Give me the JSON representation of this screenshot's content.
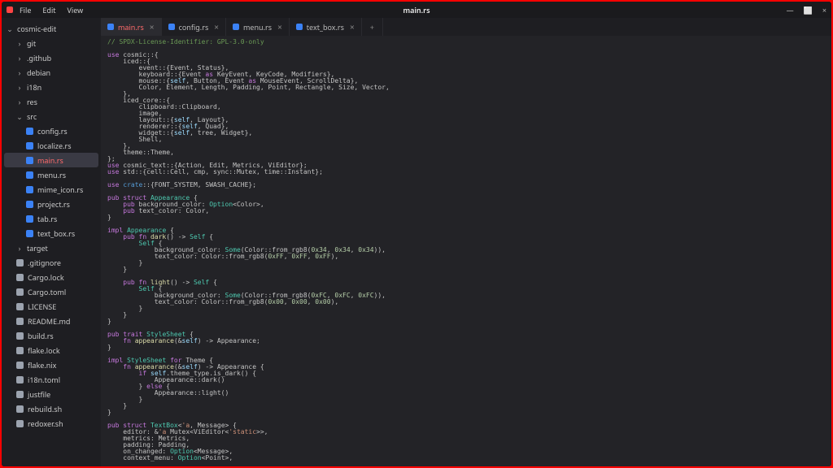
{
  "titlebar": {
    "app_icon": "cosmic-edit-icon",
    "menu": {
      "file": "File",
      "edit": "Edit",
      "view": "View"
    },
    "title": "main.rs",
    "controls": {
      "min": "—",
      "max": "⬜",
      "close": "×"
    }
  },
  "sidebar": {
    "root": {
      "label": "cosmic-edit",
      "expanded": true
    },
    "items": [
      {
        "kind": "dir",
        "label": "git",
        "depth": 1,
        "expanded": false
      },
      {
        "kind": "dir",
        "label": ".github",
        "depth": 1,
        "expanded": false
      },
      {
        "kind": "dir",
        "label": "debian",
        "depth": 1,
        "expanded": false
      },
      {
        "kind": "dir",
        "label": "i18n",
        "depth": 1,
        "expanded": false
      },
      {
        "kind": "dir",
        "label": "res",
        "depth": 1,
        "expanded": false
      },
      {
        "kind": "dir",
        "label": "src",
        "depth": 1,
        "expanded": true
      },
      {
        "kind": "file",
        "label": "config.rs",
        "depth": 2,
        "icon": "rs"
      },
      {
        "kind": "file",
        "label": "localize.rs",
        "depth": 2,
        "icon": "rs"
      },
      {
        "kind": "file",
        "label": "main.rs",
        "depth": 2,
        "icon": "rs",
        "selected": true
      },
      {
        "kind": "file",
        "label": "menu.rs",
        "depth": 2,
        "icon": "rs"
      },
      {
        "kind": "file",
        "label": "mime_icon.rs",
        "depth": 2,
        "icon": "rs"
      },
      {
        "kind": "file",
        "label": "project.rs",
        "depth": 2,
        "icon": "rs"
      },
      {
        "kind": "file",
        "label": "tab.rs",
        "depth": 2,
        "icon": "rs"
      },
      {
        "kind": "file",
        "label": "text_box.rs",
        "depth": 2,
        "icon": "rs"
      },
      {
        "kind": "dir",
        "label": "target",
        "depth": 1,
        "expanded": false
      },
      {
        "kind": "file",
        "label": ".gitignore",
        "depth": 1,
        "icon": "generic"
      },
      {
        "kind": "file",
        "label": "Cargo.lock",
        "depth": 1,
        "icon": "generic"
      },
      {
        "kind": "file",
        "label": "Cargo.toml",
        "depth": 1,
        "icon": "generic"
      },
      {
        "kind": "file",
        "label": "LICENSE",
        "depth": 1,
        "icon": "generic"
      },
      {
        "kind": "file",
        "label": "README.md",
        "depth": 1,
        "icon": "generic"
      },
      {
        "kind": "file",
        "label": "build.rs",
        "depth": 1,
        "icon": "generic"
      },
      {
        "kind": "file",
        "label": "flake.lock",
        "depth": 1,
        "icon": "generic"
      },
      {
        "kind": "file",
        "label": "flake.nix",
        "depth": 1,
        "icon": "generic"
      },
      {
        "kind": "file",
        "label": "i18n.toml",
        "depth": 1,
        "icon": "generic"
      },
      {
        "kind": "file",
        "label": "justfile",
        "depth": 1,
        "icon": "generic"
      },
      {
        "kind": "file",
        "label": "rebuild.sh",
        "depth": 1,
        "icon": "generic"
      },
      {
        "kind": "file",
        "label": "redoxer.sh",
        "depth": 1,
        "icon": "generic"
      }
    ]
  },
  "tabs": {
    "items": [
      {
        "label": "main.rs",
        "active": true
      },
      {
        "label": "config.rs",
        "active": false
      },
      {
        "label": "menu.rs",
        "active": false
      },
      {
        "label": "text_box.rs",
        "active": false
      }
    ],
    "new_tab": "+"
  },
  "code": {
    "lines": [
      [
        [
          "c",
          "// SPDX-License-Identifier: GPL-3.0-only"
        ]
      ],
      [],
      [
        [
          "kw",
          "use "
        ],
        [
          "",
          "cosmic::{"
        ]
      ],
      [
        [
          "",
          "    iced::{"
        ]
      ],
      [
        [
          "",
          "        event::{Event, Status},"
        ]
      ],
      [
        [
          "",
          "        keyboard::{Event "
        ],
        [
          "kw",
          "as"
        ],
        [
          "",
          " KeyEvent, KeyCode, Modifiers},"
        ]
      ],
      [
        [
          "",
          "        mouse::{"
        ],
        [
          "sf",
          "self"
        ],
        [
          "",
          ", Button, Event "
        ],
        [
          "kw",
          "as"
        ],
        [
          "",
          " MouseEvent, ScrollDelta},"
        ]
      ],
      [
        [
          "",
          "        Color, Element, Length, Padding, Point, Rectangle, Size, Vector,"
        ]
      ],
      [
        [
          "",
          "    },"
        ]
      ],
      [
        [
          "",
          "    iced_core::{"
        ]
      ],
      [
        [
          "",
          "        clipboard::Clipboard,"
        ]
      ],
      [
        [
          "",
          "        image,"
        ]
      ],
      [
        [
          "",
          "        layout::{"
        ],
        [
          "sf",
          "self"
        ],
        [
          "",
          ", Layout},"
        ]
      ],
      [
        [
          "",
          "        renderer::{"
        ],
        [
          "sf",
          "self"
        ],
        [
          "",
          ", Quad},"
        ]
      ],
      [
        [
          "",
          "        widget::{"
        ],
        [
          "sf",
          "self"
        ],
        [
          "",
          ", tree, Widget},"
        ]
      ],
      [
        [
          "",
          "        Shell,"
        ]
      ],
      [
        [
          "",
          "    },"
        ]
      ],
      [
        [
          "",
          "    theme::Theme,"
        ]
      ],
      [
        [
          "",
          "};"
        ]
      ],
      [
        [
          "kw",
          "use "
        ],
        [
          "",
          "cosmic_text::{Action, Edit, Metrics, ViEditor};"
        ]
      ],
      [
        [
          "kw",
          "use "
        ],
        [
          "",
          "std::{cell::Cell, cmp, sync::Mutex, time::Instant};"
        ]
      ],
      [],
      [
        [
          "kw",
          "use "
        ],
        [
          "kw2",
          "crate"
        ],
        [
          "",
          "::{FONT_SYSTEM, SWASH_CACHE};"
        ]
      ],
      [],
      [
        [
          "kw",
          "pub "
        ],
        [
          "kw",
          "struct "
        ],
        [
          "ty",
          "Appearance"
        ],
        [
          "",
          " {"
        ]
      ],
      [
        [
          "",
          "    "
        ],
        [
          "kw",
          "pub "
        ],
        [
          "",
          "background_color: "
        ],
        [
          "ty",
          "Option"
        ],
        [
          "",
          "<Color>,"
        ]
      ],
      [
        [
          "",
          "    "
        ],
        [
          "kw",
          "pub "
        ],
        [
          "",
          "text_color: Color,"
        ]
      ],
      [
        [
          "",
          "}"
        ]
      ],
      [],
      [
        [
          "kw",
          "impl "
        ],
        [
          "ty",
          "Appearance"
        ],
        [
          "",
          " {"
        ]
      ],
      [
        [
          "",
          "    "
        ],
        [
          "kw",
          "pub fn "
        ],
        [
          "fn",
          "dark"
        ],
        [
          "",
          "() -> "
        ],
        [
          "ty",
          "Self"
        ],
        [
          "",
          " {"
        ]
      ],
      [
        [
          "",
          "        "
        ],
        [
          "ty",
          "Self"
        ],
        [
          "",
          " {"
        ]
      ],
      [
        [
          "",
          "            background_color: "
        ],
        [
          "ty",
          "Some"
        ],
        [
          "",
          "(Color::from_rgb8("
        ],
        [
          "n",
          "0x34"
        ],
        [
          "",
          ", "
        ],
        [
          "n",
          "0x34"
        ],
        [
          "",
          ", "
        ],
        [
          "n",
          "0x34"
        ],
        [
          "",
          ")),"
        ]
      ],
      [
        [
          "",
          "            text_color: Color::from_rgb8("
        ],
        [
          "n",
          "0xFF"
        ],
        [
          "",
          ", "
        ],
        [
          "n",
          "0xFF"
        ],
        [
          "",
          ", "
        ],
        [
          "n",
          "0xFF"
        ],
        [
          "",
          "),"
        ]
      ],
      [
        [
          "",
          "        }"
        ]
      ],
      [
        [
          "",
          "    }"
        ]
      ],
      [],
      [
        [
          "",
          "    "
        ],
        [
          "kw",
          "pub fn "
        ],
        [
          "fn",
          "light"
        ],
        [
          "",
          "() -> "
        ],
        [
          "ty",
          "Self"
        ],
        [
          "",
          " {"
        ]
      ],
      [
        [
          "",
          "        "
        ],
        [
          "ty",
          "Self"
        ],
        [
          "",
          " {"
        ]
      ],
      [
        [
          "",
          "            background_color: "
        ],
        [
          "ty",
          "Some"
        ],
        [
          "",
          "(Color::from_rgb8("
        ],
        [
          "n",
          "0xFC"
        ],
        [
          "",
          ", "
        ],
        [
          "n",
          "0xFC"
        ],
        [
          "",
          ", "
        ],
        [
          "n",
          "0xFC"
        ],
        [
          "",
          ")),"
        ]
      ],
      [
        [
          "",
          "            text_color: Color::from_rgb8("
        ],
        [
          "n",
          "0x00"
        ],
        [
          "",
          ", "
        ],
        [
          "n",
          "0x00"
        ],
        [
          "",
          ", "
        ],
        [
          "n",
          "0x00"
        ],
        [
          "",
          "),"
        ]
      ],
      [
        [
          "",
          "        }"
        ]
      ],
      [
        [
          "",
          "    }"
        ]
      ],
      [
        [
          "",
          "}"
        ]
      ],
      [],
      [
        [
          "kw",
          "pub "
        ],
        [
          "kw",
          "trait "
        ],
        [
          "ty",
          "StyleSheet"
        ],
        [
          "",
          " {"
        ]
      ],
      [
        [
          "",
          "    "
        ],
        [
          "kw",
          "fn "
        ],
        [
          "fn",
          "appearance"
        ],
        [
          "",
          "(&"
        ],
        [
          "sf",
          "self"
        ],
        [
          "",
          ") -> Appearance;"
        ]
      ],
      [
        [
          "",
          "}"
        ]
      ],
      [],
      [
        [
          "kw",
          "impl "
        ],
        [
          "ty",
          "StyleSheet"
        ],
        [
          "",
          " "
        ],
        [
          "kw",
          "for"
        ],
        [
          "",
          " Theme {"
        ]
      ],
      [
        [
          "",
          "    "
        ],
        [
          "kw",
          "fn "
        ],
        [
          "fn",
          "appearance"
        ],
        [
          "",
          "(&"
        ],
        [
          "sf",
          "self"
        ],
        [
          "",
          ") -> Appearance {"
        ]
      ],
      [
        [
          "",
          "        "
        ],
        [
          "kw",
          "if"
        ],
        [
          "",
          " "
        ],
        [
          "sf",
          "self"
        ],
        [
          "",
          ".theme_type.is_dark() {"
        ]
      ],
      [
        [
          "",
          "            Appearance::dark()"
        ]
      ],
      [
        [
          "",
          "        } "
        ],
        [
          "kw",
          "else"
        ],
        [
          "",
          " {"
        ]
      ],
      [
        [
          "",
          "            Appearance::light()"
        ]
      ],
      [
        [
          "",
          "        }"
        ]
      ],
      [
        [
          "",
          "    }"
        ]
      ],
      [
        [
          "",
          "}"
        ]
      ],
      [],
      [
        [
          "kw",
          "pub "
        ],
        [
          "kw",
          "struct "
        ],
        [
          "ty",
          "TextBox"
        ],
        [
          "",
          "<"
        ],
        [
          "s",
          "'a"
        ],
        [
          "",
          ", Message> {"
        ]
      ],
      [
        [
          "",
          "    editor: &"
        ],
        [
          "s",
          "'a"
        ],
        [
          "",
          " Mutex<ViEditor<"
        ],
        [
          "s",
          "'static"
        ],
        [
          "",
          ">>,"
        ]
      ],
      [
        [
          "",
          "    metrics: Metrics,"
        ]
      ],
      [
        [
          "",
          "    padding: Padding,"
        ]
      ],
      [
        [
          "",
          "    on_changed: "
        ],
        [
          "ty",
          "Option"
        ],
        [
          "",
          "<Message>,"
        ]
      ],
      [
        [
          "",
          "    context_menu: "
        ],
        [
          "ty",
          "Option"
        ],
        [
          "",
          "<Point>,"
        ]
      ]
    ]
  }
}
